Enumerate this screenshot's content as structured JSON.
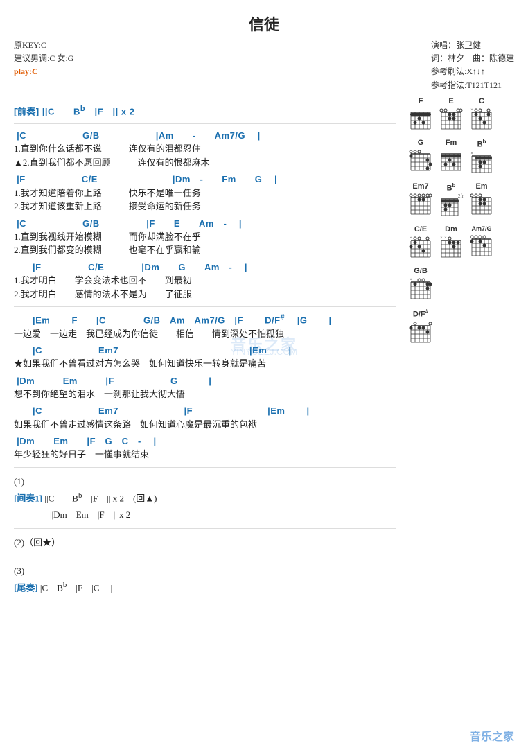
{
  "title": "信徒",
  "meta": {
    "key": "原KEY:C",
    "suggest": "建议男调:C 女:G",
    "play": "play:C",
    "performer": "演唱：张卫健",
    "lyricist": "词：林夕  曲：陈德建",
    "strum": "参考刷法:X↑↓↑",
    "finger": "参考指法:T121T121"
  },
  "watermark": "音乐之家",
  "watermark_url": "YINYUEZJ.COM",
  "footer": "音乐之家"
}
